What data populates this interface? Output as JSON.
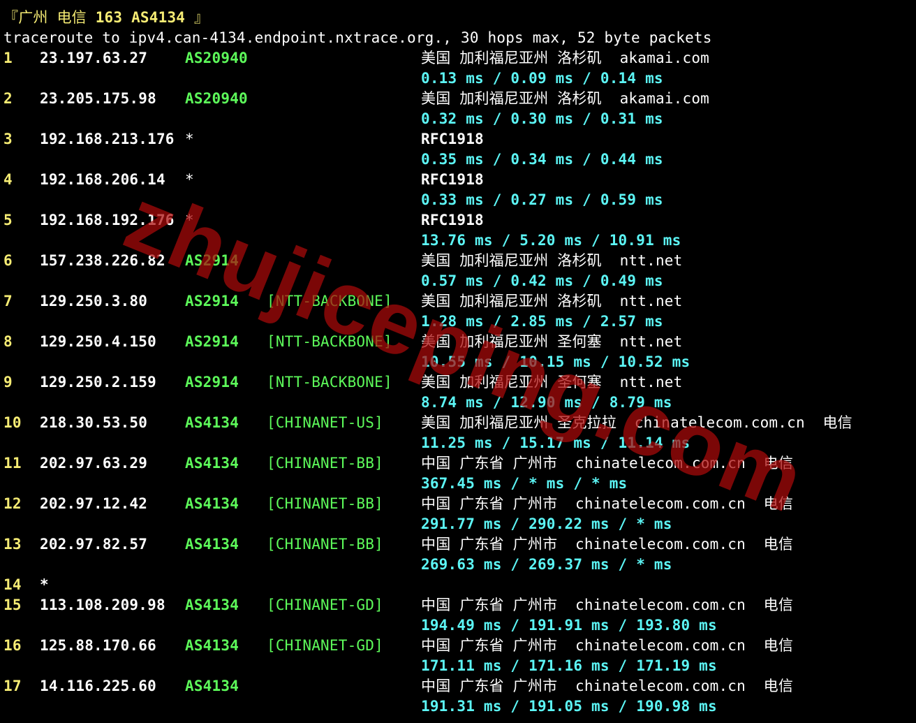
{
  "header": {
    "title_open": "『",
    "title_city": "广州 电信",
    "title_asn": "163 AS4134",
    "title_close": "』",
    "command": "traceroute to ipv4.can-4134.endpoint.nxtrace.org., 30 hops max, 52 byte packets"
  },
  "watermark": "zhujiceping.com",
  "colors": {
    "background": "#000000",
    "hop_number": "#f6ec74",
    "asn": "#5dfa5a",
    "rtt": "#5cf5f5",
    "text": "#ffffff",
    "watermark": "#aa0a0a"
  },
  "hops": [
    {
      "num": "1",
      "ip": "23.197.63.27",
      "asn": "AS20940",
      "tag": "",
      "geo": "美国 加利福尼亚州 洛杉矶  akamai.com",
      "rtt": "0.13 ms / 0.09 ms / 0.14 ms"
    },
    {
      "num": "2",
      "ip": "23.205.175.98",
      "asn": "AS20940",
      "tag": "",
      "geo": "美国 加利福尼亚州 洛杉矶  akamai.com",
      "rtt": "0.32 ms / 0.30 ms / 0.31 ms"
    },
    {
      "num": "3",
      "ip": "192.168.213.176",
      "asn": "*",
      "tag": "",
      "geo": "RFC1918",
      "rtt": "0.35 ms / 0.34 ms / 0.44 ms"
    },
    {
      "num": "4",
      "ip": "192.168.206.14",
      "asn": "*",
      "tag": "",
      "geo": "RFC1918",
      "rtt": "0.33 ms / 0.27 ms / 0.59 ms"
    },
    {
      "num": "5",
      "ip": "192.168.192.176",
      "asn": "*",
      "tag": "",
      "geo": "RFC1918",
      "rtt": "13.76 ms / 5.20 ms / 10.91 ms"
    },
    {
      "num": "6",
      "ip": "157.238.226.82",
      "asn": "AS2914",
      "tag": "",
      "geo": "美国 加利福尼亚州 洛杉矶  ntt.net",
      "rtt": "0.57 ms / 0.42 ms / 0.49 ms"
    },
    {
      "num": "7",
      "ip": "129.250.3.80",
      "asn": "AS2914",
      "tag": "[NTT-BACKBONE]",
      "geo": "美国 加利福尼亚州 洛杉矶  ntt.net",
      "rtt": "1.28 ms / 2.85 ms / 2.57 ms"
    },
    {
      "num": "8",
      "ip": "129.250.4.150",
      "asn": "AS2914",
      "tag": "[NTT-BACKBONE]",
      "geo": "美国 加利福尼亚州 圣何塞  ntt.net",
      "rtt": "10.55 ms / 10.15 ms / 10.52 ms"
    },
    {
      "num": "9",
      "ip": "129.250.2.159",
      "asn": "AS2914",
      "tag": "[NTT-BACKBONE]",
      "geo": "美国 加利福尼亚州 圣何塞  ntt.net",
      "rtt": "8.74 ms / 12.90 ms / 8.79 ms"
    },
    {
      "num": "10",
      "ip": "218.30.53.50",
      "asn": "AS4134",
      "tag": "[CHINANET-US]",
      "geo": "美国 加利福尼亚州 圣克拉拉  chinatelecom.com.cn  电信",
      "rtt": "11.25 ms / 15.17 ms / 11.14 ms"
    },
    {
      "num": "11",
      "ip": "202.97.63.29",
      "asn": "AS4134",
      "tag": "[CHINANET-BB]",
      "geo": "中国 广东省 广州市  chinatelecom.com.cn  电信",
      "rtt": "367.45 ms / * ms / * ms"
    },
    {
      "num": "12",
      "ip": "202.97.12.42",
      "asn": "AS4134",
      "tag": "[CHINANET-BB]",
      "geo": "中国 广东省 广州市  chinatelecom.com.cn  电信",
      "rtt": "291.77 ms / 290.22 ms / * ms"
    },
    {
      "num": "13",
      "ip": "202.97.82.57",
      "asn": "AS4134",
      "tag": "[CHINANET-BB]",
      "geo": "中国 广东省 广州市  chinatelecom.com.cn  电信",
      "rtt": "269.63 ms / 269.37 ms / * ms"
    },
    {
      "num": "14",
      "ip": "*",
      "asn": "",
      "tag": "",
      "geo": "",
      "rtt": ""
    },
    {
      "num": "15",
      "ip": "113.108.209.98",
      "asn": "AS4134",
      "tag": "[CHINANET-GD]",
      "geo": "中国 广东省 广州市  chinatelecom.com.cn  电信",
      "rtt": "194.49 ms / 191.91 ms / 193.80 ms"
    },
    {
      "num": "16",
      "ip": "125.88.170.66",
      "asn": "AS4134",
      "tag": "[CHINANET-GD]",
      "geo": "中国 广东省 广州市  chinatelecom.com.cn  电信",
      "rtt": "171.11 ms / 171.16 ms / 171.19 ms"
    },
    {
      "num": "17",
      "ip": "14.116.225.60",
      "asn": "AS4134",
      "tag": "",
      "geo": "中国 广东省 广州市  chinatelecom.com.cn  电信",
      "rtt": "191.31 ms / 191.05 ms / 190.98 ms"
    }
  ]
}
